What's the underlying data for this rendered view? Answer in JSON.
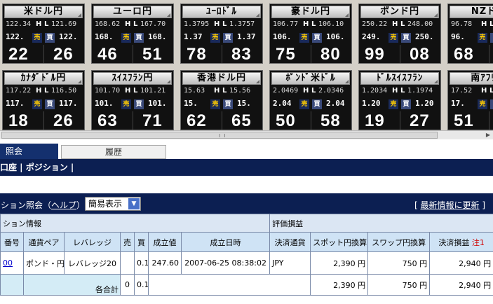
{
  "tiles": [
    {
      "name": "米ドル円",
      "low_label": "H",
      "high_label": "L",
      "bid_full": "122.34",
      "ask_full": "121.69",
      "bid_short": "122.",
      "ask_short": "122.",
      "sell": "売",
      "buy": "買",
      "bid_pips": "22",
      "ask_pips": "26"
    },
    {
      "name": "ユーロ円",
      "low_label": "H",
      "high_label": "L",
      "bid_full": "168.62",
      "ask_full": "167.70",
      "bid_short": "168.",
      "ask_short": "168.",
      "sell": "売",
      "buy": "買",
      "bid_pips": "46",
      "ask_pips": "51"
    },
    {
      "name": "ﾕｰﾛﾄﾞﾙ",
      "low_label": "H",
      "high_label": "L",
      "bid_full": "1.3795",
      "ask_full": "1.3757",
      "bid_short": "1.37",
      "ask_short": "1.37",
      "sell": "売",
      "buy": "買",
      "bid_pips": "78",
      "ask_pips": "83"
    },
    {
      "name": "豪ドル円",
      "low_label": "H",
      "high_label": "L",
      "bid_full": "106.77",
      "ask_full": "106.10",
      "bid_short": "106.",
      "ask_short": "106.",
      "sell": "売",
      "buy": "買",
      "bid_pips": "75",
      "ask_pips": "80"
    },
    {
      "name": "ポンド円",
      "low_label": "H",
      "high_label": "L",
      "bid_full": "250.22",
      "ask_full": "248.00",
      "bid_short": "249.",
      "ask_short": "250.",
      "sell": "売",
      "buy": "買",
      "bid_pips": "99",
      "ask_pips": "08"
    },
    {
      "name": "NZドル",
      "low_label": "H",
      "high_label": "L",
      "bid_full": "96.78",
      "ask_full": "",
      "bid_short": "96.",
      "ask_short": "",
      "sell": "売",
      "buy": "",
      "bid_pips": "68",
      "ask_pips": ""
    },
    {
      "name": "ｶﾅﾀﾞﾄﾞﾙ円",
      "low_label": "H",
      "high_label": "L",
      "bid_full": "117.22",
      "ask_full": "116.50",
      "bid_short": "117.",
      "ask_short": "117.",
      "sell": "売",
      "buy": "買",
      "bid_pips": "18",
      "ask_pips": "26"
    },
    {
      "name": "ｽｲｽﾌﾗﾝ円",
      "low_label": "H",
      "high_label": "L",
      "bid_full": "101.70",
      "ask_full": "101.21",
      "bid_short": "101.",
      "ask_short": "101.",
      "sell": "売",
      "buy": "買",
      "bid_pips": "63",
      "ask_pips": "71"
    },
    {
      "name": "香港ドル円",
      "low_label": "H",
      "high_label": "L",
      "bid_full": "15.63",
      "ask_full": "15.56",
      "bid_short": "15.",
      "ask_short": "15.",
      "sell": "売",
      "buy": "買",
      "bid_pips": "62",
      "ask_pips": "65"
    },
    {
      "name": "ﾎﾟﾝﾄﾞ米ﾄﾞﾙ",
      "low_label": "H",
      "high_label": "L",
      "bid_full": "2.0469",
      "ask_full": "2.0346",
      "bid_short": "2.04",
      "ask_short": "2.04",
      "sell": "売",
      "buy": "買",
      "bid_pips": "50",
      "ask_pips": "58"
    },
    {
      "name": "ﾄﾞﾙｽｲｽﾌﾗﾝ",
      "low_label": "H",
      "high_label": "L",
      "bid_full": "1.2034",
      "ask_full": "1.1974",
      "bid_short": "1.20",
      "ask_short": "1.20",
      "sell": "売",
      "buy": "買",
      "bid_pips": "19",
      "ask_pips": "27"
    },
    {
      "name": "南ｱﾌﾘｶﾗ",
      "low_label": "H",
      "high_label": "L",
      "bid_full": "17.52",
      "ask_full": "",
      "bid_short": "17.",
      "ask_short": "",
      "sell": "売",
      "buy": "",
      "bid_pips": "51",
      "ask_pips": ""
    }
  ],
  "tabs": {
    "active": "照会",
    "inactive": "履歴"
  },
  "nav": {
    "text": "口座 | ポジション |"
  },
  "section": {
    "title": "ション照会（",
    "help": "ヘルプ",
    "title_end": "）",
    "select_value": "簡易表示",
    "refresh_open": "[",
    "refresh_link": "最新情報に更新",
    "refresh_close": "]"
  },
  "table": {
    "group_left": "ション情報",
    "group_right": "評価損益",
    "headers": [
      "番号",
      "通貨ペア",
      "レバレッジ",
      "売",
      "買",
      "成立値",
      "成立日時",
      "決済通貨",
      "スポット円換算",
      "スワップ円換算",
      "決済損益"
    ],
    "note": "注1",
    "row": {
      "number": "00",
      "pair": "ポンド・円",
      "leverage": "レバレッジ20",
      "sell": "",
      "buy": "0.1",
      "price": "247.60",
      "datetime": "2007-06-25 08:38:02",
      "currency": "JPY",
      "spot": "2,390 円",
      "swap": "750 円",
      "pl": "2,940 円"
    },
    "total": {
      "label": "各合計",
      "sell": "0",
      "buy": "0.1",
      "spot": "2,390 円",
      "swap": "750 円",
      "pl": "2,940 円"
    }
  }
}
